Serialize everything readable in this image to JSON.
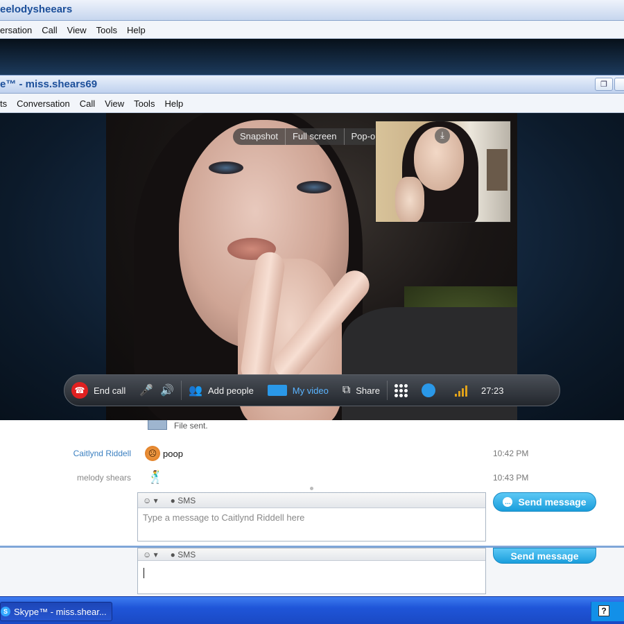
{
  "back_window": {
    "title": "eelodysheears",
    "menu": [
      "ersation",
      "Call",
      "View",
      "Tools",
      "Help"
    ]
  },
  "front_window": {
    "title": "e™ - miss.shears69",
    "menu": [
      "ts",
      "Conversation",
      "Call",
      "View",
      "Tools",
      "Help"
    ],
    "restore_icon": "restore-icon"
  },
  "video": {
    "overlay_buttons": [
      "Snapshot",
      "Full screen",
      "Pop-out"
    ],
    "pip_icon": "download-icon"
  },
  "call_bar": {
    "end_call": "End call",
    "add_people": "Add people",
    "my_video": "My video",
    "share": "Share",
    "duration": "27:23",
    "colors": {
      "end_call": "#e02020",
      "my_video": "#5ab4ff",
      "signal": "#e0a21a"
    }
  },
  "chat": {
    "file_notice": "File sent.",
    "messages": [
      {
        "sender": "Caitlynd Riddell",
        "sender_color": "#3a7fc0",
        "text": "poop",
        "emoticon": "angry-emoticon",
        "time": "10:42 PM"
      },
      {
        "sender": "melody shears",
        "sender_color": "#888888",
        "text": "",
        "emoticon": "dancing-emoticon",
        "time": "10:43 PM"
      }
    ],
    "composer": {
      "sms_label": "SMS",
      "placeholder": "Type a message to Caitlynd Riddell here",
      "send_label": "Send message"
    },
    "lower_composer": {
      "sms_label": "SMS",
      "send_label": "Send message"
    }
  },
  "taskbar": {
    "task_label": "Skype™ - miss.shear...",
    "help_icon": "?"
  }
}
